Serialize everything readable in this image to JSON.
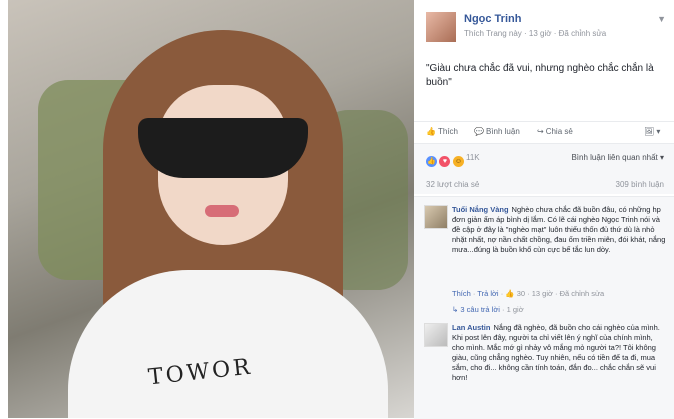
{
  "post": {
    "author": "Ngọc Trinh",
    "meta": "Thích Trang này · 13 giờ · Đã chỉnh sửa",
    "text": "\"Giàu chưa chắc đã vui, nhưng nghèo chắc chắn là buồn\"",
    "shirt_text": "TOWOR"
  },
  "actions": {
    "like": "Thích",
    "comment": "Bình luận",
    "share": "Chia sẻ"
  },
  "reactions": {
    "count": "11K",
    "sort": "Bình luận liên quan nhất ▾"
  },
  "stats": {
    "shares": "32 lượt chia sẻ",
    "comments": "309 bình luận"
  },
  "comments": [
    {
      "name": "Tuổi Nắng Vàng",
      "text": "Nghèo chưa chắc đã buồn đâu, có những hp đơn giản ấm áp bình dị lắm. Có lẽ cái nghèo Ngọc Trinh nói và đề cập ở đây là \"nghèo mạt\" luôn thiếu thốn đủ thứ dù là nhỏ nhặt nhất, nợ nần chất chồng, đau ốm triền miên, đói khát, nắng mưa...đúng là buồn khổ cùn cực bế tắc lun dòy.",
      "like": "Thích",
      "reply": "Trả lời",
      "count": "30",
      "time": "13 giờ",
      "edited": "Đã chỉnh sửa",
      "replies": "3 câu trả lời",
      "replies_time": "1 giờ"
    },
    {
      "name": "Lan Austin",
      "text": "Nắng đã nghèo, đã buồn cho cái nghèo của mình. Khi post lên đây, người ta chỉ viết lên ý nghĩ của chính mình, cho mình. Mắc mớ gì nhảy vô mắng mỏ người ta?! Tôi không giàu, cũng chẳng nghèo. Tuy nhiên, nếu có tiền để ta đi, mua sắm, cho đi... không cần tính toán, đắn đo... chắc chắn sẽ vui hơn!"
    }
  ]
}
